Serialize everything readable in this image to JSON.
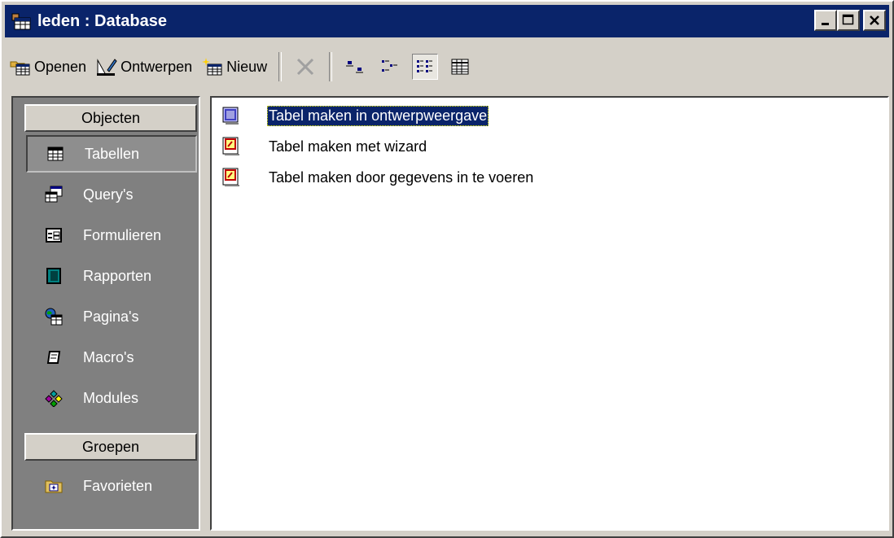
{
  "window": {
    "title": "leden : Database",
    "icon": "database-window-icon",
    "controls": [
      "minimize-icon",
      "maximize-icon",
      "close-icon"
    ]
  },
  "toolbar": {
    "open_label": "Openen",
    "design_label": "Ontwerpen",
    "new_label": "Nieuw",
    "icons": [
      "delete-icon",
      "large-icons-icon",
      "small-icons-icon",
      "list-view-icon",
      "details-view-icon"
    ]
  },
  "sidebar": {
    "objects_header": "Objecten",
    "items": [
      {
        "label": "Tabellen",
        "icon": "table-icon",
        "selected": true
      },
      {
        "label": "Query's",
        "icon": "query-icon"
      },
      {
        "label": "Formulieren",
        "icon": "form-icon"
      },
      {
        "label": "Rapporten",
        "icon": "report-icon"
      },
      {
        "label": "Pagina's",
        "icon": "page-icon"
      },
      {
        "label": "Macro's",
        "icon": "macro-icon"
      },
      {
        "label": "Modules",
        "icon": "module-icon"
      }
    ],
    "groups_header": "Groepen",
    "groups": [
      {
        "label": "Favorieten",
        "icon": "favorites-folder-icon"
      }
    ]
  },
  "list": {
    "items": [
      {
        "label": "Tabel maken in ontwerpweergave",
        "icon": "design-view-icon",
        "selected": true
      },
      {
        "label": "Tabel maken met wizard",
        "icon": "wizard-icon"
      },
      {
        "label": "Tabel maken door gegevens in te voeren",
        "icon": "wizard-icon"
      }
    ]
  },
  "colors": {
    "titlebar": "#0a246a",
    "face": "#d4d0c8",
    "objbar": "#808080",
    "selection": "#0a246a"
  }
}
